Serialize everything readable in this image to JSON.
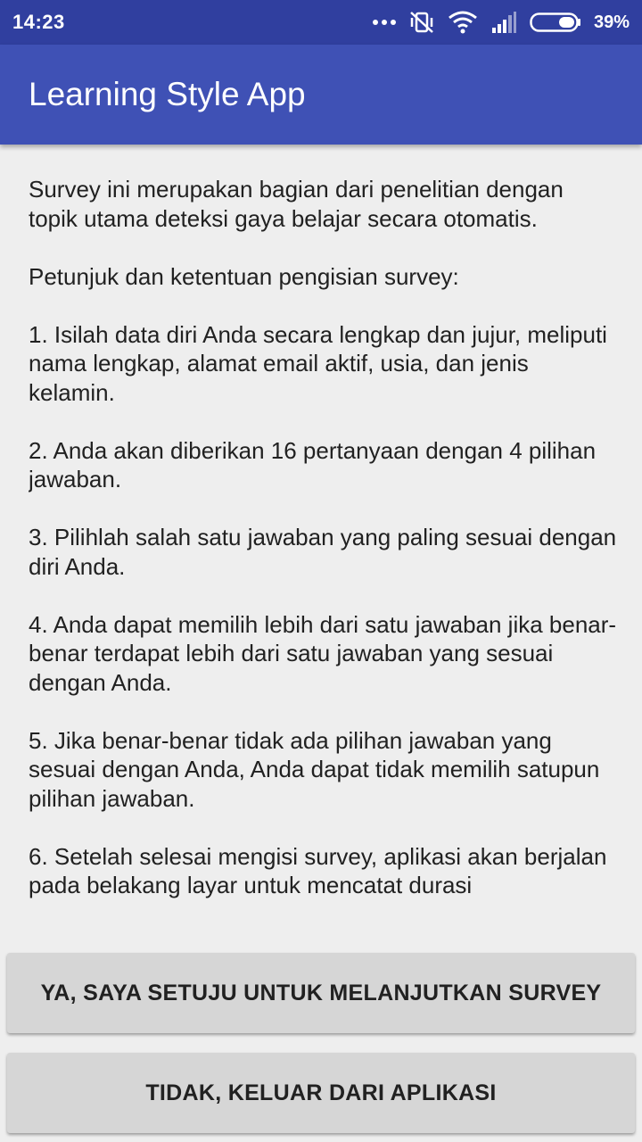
{
  "status_bar": {
    "time": "14:23",
    "battery": "39%",
    "icons": [
      "more-dots-icon",
      "vibrate-off-icon",
      "wifi-icon",
      "signal-icon",
      "battery-icon"
    ]
  },
  "app_bar": {
    "title": "Learning Style App"
  },
  "content": {
    "paragraphs": [
      "Survey ini merupakan bagian dari penelitian dengan topik utama deteksi gaya belajar secara otomatis.",
      "Petunjuk dan ketentuan pengisian survey:",
      "1. Isilah data diri Anda secara lengkap dan jujur, meliputi nama lengkap, alamat email aktif, usia, dan jenis kelamin.",
      "2. Anda akan diberikan 16 pertanyaan dengan 4 pilihan jawaban.",
      "3. Pilihlah salah satu jawaban yang paling sesuai dengan diri Anda.",
      "4. Anda dapat memilih lebih dari satu jawaban jika benar-benar terdapat lebih dari satu jawaban yang sesuai dengan Anda.",
      "5. Jika benar-benar tidak ada pilihan jawaban yang sesuai dengan Anda, Anda dapat tidak memilih satupun pilihan jawaban.",
      "6. Setelah selesai mengisi survey, aplikasi akan berjalan pada belakang layar untuk mencatat durasi"
    ]
  },
  "buttons": {
    "agree": "YA, SAYA SETUJU UNTUK MELANJUTKAN SURVEY",
    "exit": "TIDAK, KELUAR DARI APLIKASI"
  },
  "colors": {
    "status_bar": "#303f9f",
    "app_bar": "#3f51b5",
    "background": "#eeeeee",
    "button": "#d6d6d6"
  }
}
